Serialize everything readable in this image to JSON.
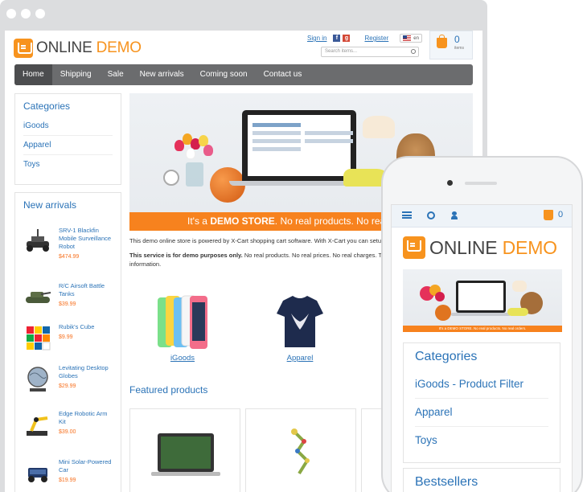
{
  "desktop": {
    "logo": {
      "word1": "ONLINE",
      "word2": "DEMO"
    },
    "top_links": {
      "signin": "Sign in",
      "register": "Register",
      "language": "en"
    },
    "search": {
      "placeholder": "Search items..."
    },
    "cart": {
      "count": "0",
      "label": "items"
    },
    "nav": [
      "Home",
      "Shipping",
      "Sale",
      "New arrivals",
      "Coming soon",
      "Contact us"
    ],
    "categories": {
      "title": "Categories",
      "items": [
        "iGoods",
        "Apparel",
        "Toys"
      ]
    },
    "new_arrivals": {
      "title": "New arrivals",
      "items": [
        {
          "name": "SRV-1 Blackfin Mobile Surveillance Robot",
          "price": "$474.99"
        },
        {
          "name": "R/C Airsoft Battle Tanks",
          "price": "$39.99"
        },
        {
          "name": "Rubik's Cube",
          "price": "$9.99"
        },
        {
          "name": "Levitating Desktop Globes",
          "price": "$29.99"
        },
        {
          "name": "Edge Robotic Arm Kit",
          "price": "$39.00"
        },
        {
          "name": "Mini Solar-Powered Car",
          "price": "$19.99"
        }
      ]
    },
    "banner": {
      "prefix": "It's a ",
      "highlight": "DEMO STORE",
      "suffix": ". No real products. No real"
    },
    "description": {
      "p1": "This demo online store is powered by X-Cart shopping cart software. With X-Cart you can setup a we demo has.",
      "p2_bold": "This service is for demo purposes only.",
      "p2_rest": " No real products. No real prices. No real charges. Th submit real credit card information."
    },
    "category_tiles": [
      "iGoods",
      "Apparel"
    ],
    "featured_title": "Featured products"
  },
  "mobile": {
    "logo": {
      "word1": "ONLINE",
      "word2": "DEMO"
    },
    "cart_count": "0",
    "banner_text": "It's a DEMO STORE. No real products. No real orders.",
    "categories": {
      "title": "Categories",
      "items": [
        "iGoods - Product Filter",
        "Apparel",
        "Toys"
      ]
    },
    "bestsellers_title": "Bestsellers"
  },
  "colors": {
    "accent": "#f7931e",
    "link": "#2b73b7",
    "nav": "#6b6c6e"
  }
}
